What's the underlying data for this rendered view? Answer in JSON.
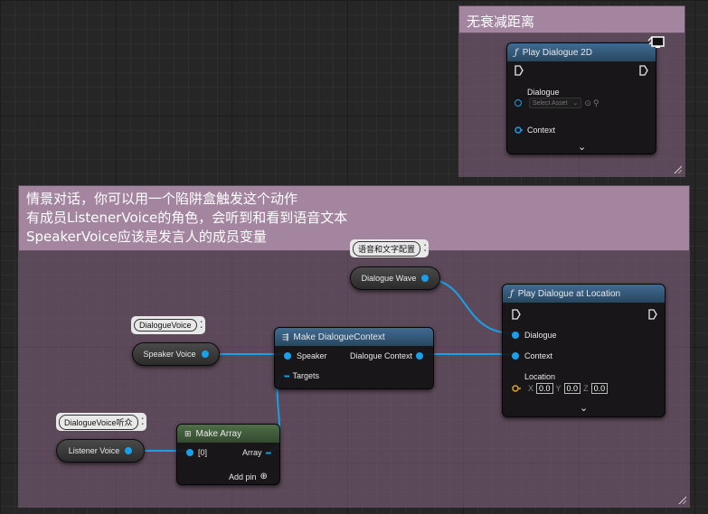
{
  "comment_top": {
    "title": "无衰减距离"
  },
  "comment_main": {
    "lines": [
      "情景对话，你可以用一个陷阱盒触发这个动作",
      "有成员ListenerVoice的角色，会听到和看到语音文本",
      "SpeakerVoice应该是发言人的成员变量"
    ]
  },
  "node_play2d": {
    "title": "Play Dialogue 2D",
    "pin_dialogue": "Dialogue",
    "asset_placeholder": "Select Asset",
    "pin_context": "Context",
    "expand": "⌄",
    "corner_icon": "monitor-icon"
  },
  "node_playloc": {
    "title": "Play Dialogue at Location",
    "pin_dialogue": "Dialogue",
    "pin_context": "Context",
    "pin_location": "Location",
    "x_label": "X",
    "x_value": "0.0",
    "y_label": "Y",
    "y_value": "0.0",
    "z_label": "Z",
    "z_value": "0.0"
  },
  "node_makecontext": {
    "title": "Make DialogueContext",
    "pin_speaker": "Speaker",
    "pin_targets": "Targets",
    "pin_out": "Dialogue Context"
  },
  "node_makearray": {
    "title": "Make Array",
    "pin_in": "[0]",
    "pin_out": "Array",
    "add_pin": "Add pin"
  },
  "var_wave": {
    "label": "Dialogue Wave",
    "bubble": "语音和文字配置"
  },
  "var_speaker": {
    "label": "Speaker Voice",
    "bubble": "DialogueVoice"
  },
  "var_listener": {
    "label": "Listener Voice",
    "bubble": "DialogueVoice听众"
  },
  "colors": {
    "pin_blue": "#1aa0e8",
    "pin_gold": "#e0a52b",
    "comment": "#a385a0"
  }
}
